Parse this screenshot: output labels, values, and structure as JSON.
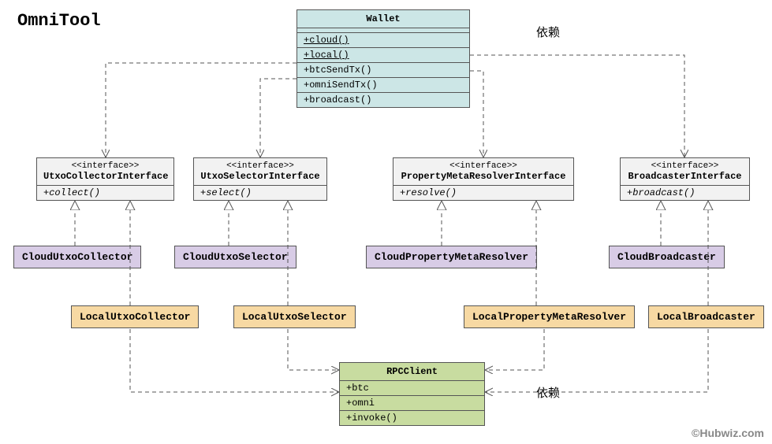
{
  "title": "OmniTool",
  "notes": {
    "dep1": "依赖",
    "dep2": "依赖"
  },
  "copyright": "©Hubwiz.com",
  "wallet": {
    "name": "Wallet",
    "static_methods": [
      "+cloud()",
      "+local()"
    ],
    "methods": [
      "+btcSendTx()",
      "+omniSendTx()",
      "+broadcast()"
    ]
  },
  "interfaces": {
    "utxo_collector": {
      "stereo": "<<interface>>",
      "name": "UtxoCollectorInterface",
      "method": "+collect()"
    },
    "utxo_selector": {
      "stereo": "<<interface>>",
      "name": "UtxoSelectorInterface",
      "method": "+select()"
    },
    "prop_resolver": {
      "stereo": "<<interface>>",
      "name": "PropertyMetaResolverInterface",
      "method": "+resolve()"
    },
    "broadcaster": {
      "stereo": "<<interface>>",
      "name": "BroadcasterInterface",
      "method": "+broadcast()"
    }
  },
  "cloud_impls": {
    "utxo_collector": "CloudUtxoCollector",
    "utxo_selector": "CloudUtxoSelector",
    "prop_resolver": "CloudPropertyMetaResolver",
    "broadcaster": "CloudBroadcaster"
  },
  "local_impls": {
    "utxo_collector": "LocalUtxoCollector",
    "utxo_selector": "LocalUtxoSelector",
    "prop_resolver": "LocalPropertyMetaResolver",
    "broadcaster": "LocalBroadcaster"
  },
  "rpc": {
    "name": "RPCClient",
    "attrs": [
      "+btc",
      "+omni"
    ],
    "method": "+invoke()"
  }
}
